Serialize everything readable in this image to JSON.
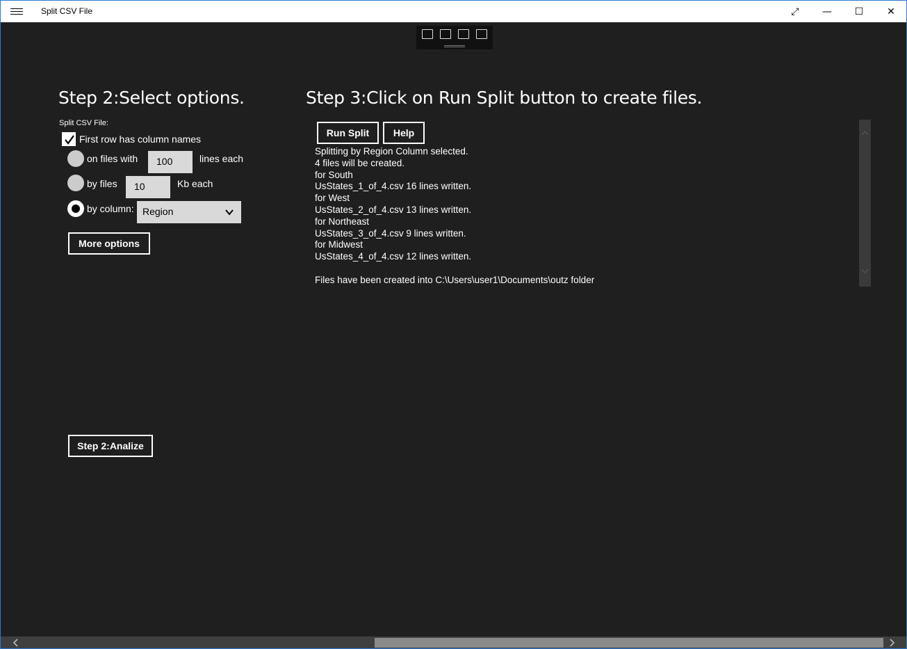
{
  "window": {
    "title": "Split CSV File",
    "controls": {
      "expand": "⤢",
      "minimize": "—",
      "maximize": "☐",
      "close": "✕"
    }
  },
  "step2": {
    "heading": "Step 2:Select options.",
    "section_label": "Split CSV File:",
    "first_row_checkbox_label": "First row has column names",
    "first_row_checked": true,
    "option_lines": {
      "prefix": "on files with",
      "value": "100",
      "suffix": "lines each",
      "selected": false
    },
    "option_size": {
      "prefix": "by files",
      "value": "10",
      "suffix": "Kb each",
      "selected": false
    },
    "option_column": {
      "prefix": "by column:",
      "value": "Region",
      "selected": true
    },
    "more_options_label": "More options",
    "analyze_label": "Step 2:Analize"
  },
  "step3": {
    "heading": "Step 3:Click on Run Split button to create files.",
    "run_split_label": "Run Split",
    "help_label": "Help",
    "output_lines": [
      "Splitting by Region Column selected.",
      "4 files will be created.",
      "for South",
      "UsStates_1_of_4.csv 16 lines written.",
      "for West",
      "UsStates_2_of_4.csv 13 lines written.",
      "for Northeast",
      "UsStates_3_of_4.csv 9 lines written.",
      "for Midwest",
      "UsStates_4_of_4.csv 12 lines written.",
      "",
      "Files have been created into C:\\Users\\user1\\Documents\\outz folder"
    ]
  },
  "colors": {
    "background": "#1f1f1f",
    "text": "#ffffff",
    "input_bg": "#d9d9d9",
    "accent_border": "#2b79d7"
  },
  "icons": {
    "menu": "hamburger-icon",
    "dev_tools": [
      "live-tree-icon",
      "select-element-icon",
      "layout-adorner-icon",
      "track-focus-icon"
    ]
  }
}
